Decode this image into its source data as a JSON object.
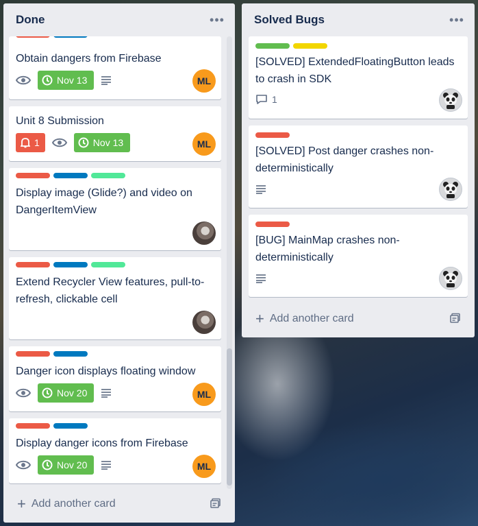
{
  "colors": {
    "label_red": "#eb5a46",
    "label_blue": "#0079bf",
    "label_teal": "#51e898",
    "label_green": "#61bd4f",
    "label_yellow": "#f2d600",
    "due_green": "#61bd4f",
    "notification_red": "#eb5a46",
    "avatar_orange": "#f89a1c"
  },
  "lists": [
    {
      "title": "Done",
      "menu_icon": "more-horizontal-icon",
      "add_card_label": "Add another card",
      "cards": [
        {
          "labels": [
            "red",
            "blue"
          ],
          "title": "Obtain dangers from Firebase",
          "watching": true,
          "due": "Nov 13",
          "has_description": true,
          "member": "ML"
        },
        {
          "labels": [],
          "title": "Unit 8 Submission",
          "notifications": "1",
          "watching": true,
          "due": "Nov 13",
          "member": "ML"
        },
        {
          "labels": [
            "red",
            "blue",
            "teal"
          ],
          "title": "Display image (Glide?) and video on DangerItemView",
          "member": "photo"
        },
        {
          "labels": [
            "red",
            "blue",
            "teal"
          ],
          "title": "Extend Recycler View features, pull-to-refresh, clickable cell",
          "member": "photo"
        },
        {
          "labels": [
            "red",
            "blue"
          ],
          "title": "Danger icon displays floating window",
          "watching": true,
          "due": "Nov 20",
          "has_description": true,
          "member": "ML"
        },
        {
          "labels": [
            "red",
            "blue"
          ],
          "title": "Display danger icons from Firebase",
          "watching": true,
          "due": "Nov 20",
          "has_description": true,
          "member": "ML"
        }
      ]
    },
    {
      "title": "Solved Bugs",
      "menu_icon": "more-horizontal-icon",
      "add_card_label": "Add another card",
      "cards": [
        {
          "labels": [
            "green",
            "yellow"
          ],
          "title": "[SOLVED] ExtendedFloatingButton leads to crash in SDK",
          "comments": "1",
          "member": "panda"
        },
        {
          "labels": [
            "red"
          ],
          "title": "[SOLVED] Post danger crashes non-deterministically",
          "has_description": true,
          "member": "panda"
        },
        {
          "labels": [
            "red"
          ],
          "title": "[BUG] MainMap crashes non-deterministically",
          "has_description": true,
          "member": "panda"
        }
      ]
    }
  ]
}
